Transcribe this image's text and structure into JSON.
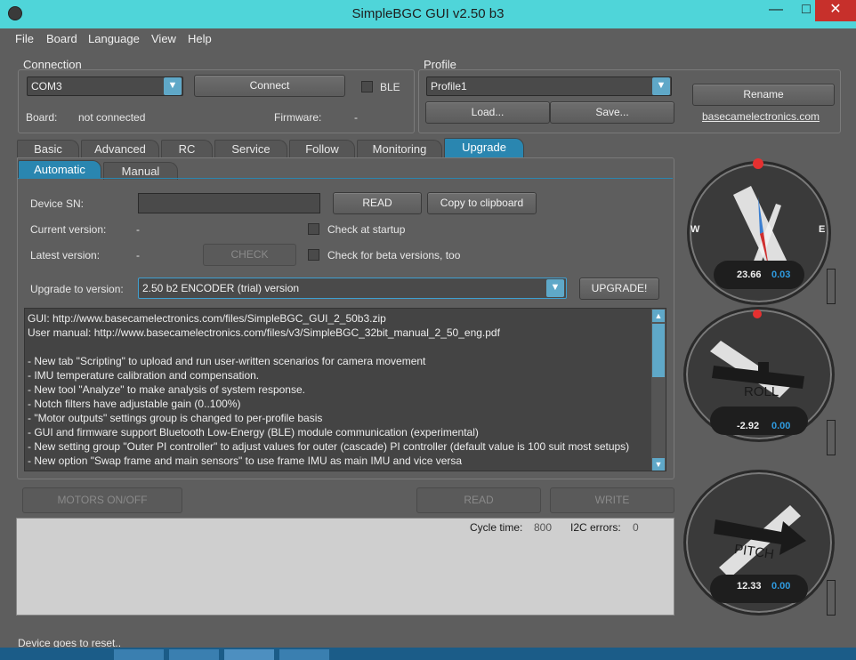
{
  "window": {
    "title": "SimpleBGC GUI v2.50 b3",
    "minimize": "—",
    "maximize": "□",
    "close": "✕"
  },
  "menu": [
    "File",
    "Board",
    "Language",
    "View",
    "Help"
  ],
  "connection": {
    "label": "Connection",
    "port": "COM3",
    "connect": "Connect",
    "ble": "BLE",
    "board_label": "Board:",
    "board_value": "not connected",
    "firmware_label": "Firmware:",
    "firmware_value": "-"
  },
  "profile": {
    "label": "Profile",
    "value": "Profile1",
    "load": "Load...",
    "save": "Save...",
    "rename": "Rename",
    "link": "basecamelectronics.com"
  },
  "tabs": [
    "Basic",
    "Advanced",
    "RC",
    "Service",
    "Follow",
    "Monitoring",
    "Upgrade"
  ],
  "active_tab": "Upgrade",
  "subtabs": [
    "Automatic",
    "Manual"
  ],
  "upgrade": {
    "device_sn_label": "Device SN:",
    "device_sn_value": "",
    "read": "READ",
    "copy": "Copy to clipboard",
    "current_label": "Current version:",
    "current_value": "-",
    "check_startup": "Check at startup",
    "latest_label": "Latest version:",
    "latest_value": "-",
    "check": "CHECK",
    "check_beta": "Check for beta versions, too",
    "upgrade_to_label": "Upgrade to version:",
    "upgrade_to_value": "2.50 b2 ENCODER  (trial) version",
    "upgrade_button": "UPGRADE!"
  },
  "log": [
    "GUI: http://www.basecamelectronics.com/files/SimpleBGC_GUI_2_50b3.zip",
    "User manual: http://www.basecamelectronics.com/files/v3/SimpleBGC_32bit_manual_2_50_eng.pdf",
    "",
    "- New tab \"Scripting\" to upload and run user-written scenarios for camera movement",
    "- IMU temperature calibration and compensation.",
    "- New tool \"Analyze\" to make analysis of system response.",
    "- Notch filters have adjustable gain (0..100%)",
    "- \"Motor outputs\" settings group is changed to per-profile basis",
    "- GUI and firmware support Bluetooth Low-Energy (BLE) module communication (experimental)",
    "- New setting group \"Outer PI controller\" to adjust values for outer (cascade) PI controller (default value is 100 suit most setups)",
    "- New option \"Swap frame and main sensors\" to use frame IMU as main IMU and vice versa"
  ],
  "bottom": {
    "motors": "MOTORS ON/OFF",
    "read": "READ",
    "write": "WRITE",
    "cycle_label": "Cycle time:",
    "cycle_value": "800",
    "i2c_label": "I2C errors:",
    "i2c_value": "0"
  },
  "gauges": {
    "yaw": {
      "value": "23.66",
      "rate": "0.03",
      "west": "W",
      "east": "E"
    },
    "roll": {
      "label": "ROLL",
      "value": "-2.92",
      "rate": "0.00"
    },
    "pitch": {
      "label": "PITCH",
      "value": "12.33",
      "rate": "0.00"
    }
  },
  "status": "Device goes to reset..",
  "colors": {
    "accent": "#2a86b0",
    "rate": "#2f9be0",
    "marker": "#e53030"
  }
}
